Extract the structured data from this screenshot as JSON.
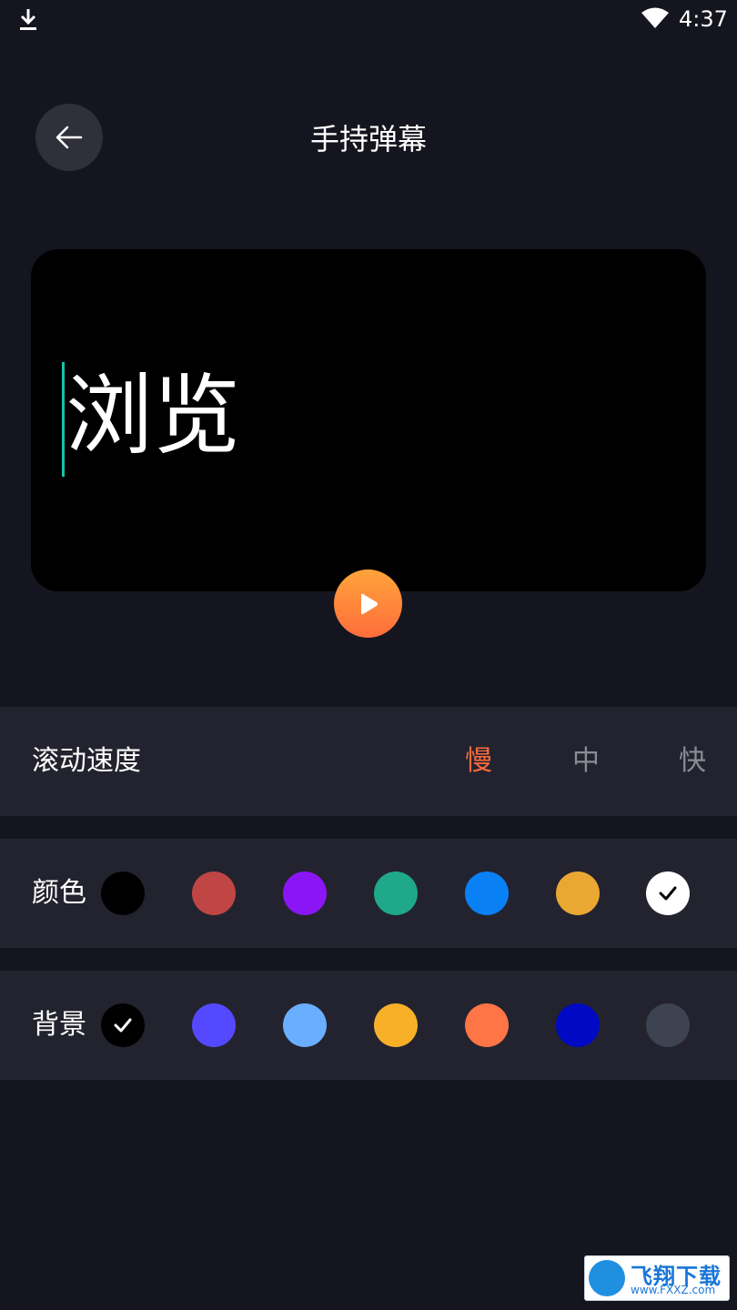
{
  "status_bar": {
    "time": "4:37"
  },
  "header": {
    "title": "手持弹幕"
  },
  "preview": {
    "text": "浏览"
  },
  "speed": {
    "label": "滚动速度",
    "options": [
      "慢",
      "中",
      "快"
    ],
    "selected": "慢"
  },
  "text_color": {
    "label": "颜色",
    "swatches": [
      "#000000",
      "#c04545",
      "#8b16f5",
      "#1fa88a",
      "#0a80f5",
      "#eaa832",
      "#ffffff"
    ],
    "selected_index": 6
  },
  "background": {
    "label": "背景",
    "swatches": [
      "#000000",
      "#5549ff",
      "#6aaeff",
      "#f8b028",
      "#ff7546",
      "#0009c3",
      "#3d4350"
    ],
    "selected_index": 0
  },
  "watermark": {
    "name": "飞翔下载",
    "url": "www.FXXZ.com"
  }
}
